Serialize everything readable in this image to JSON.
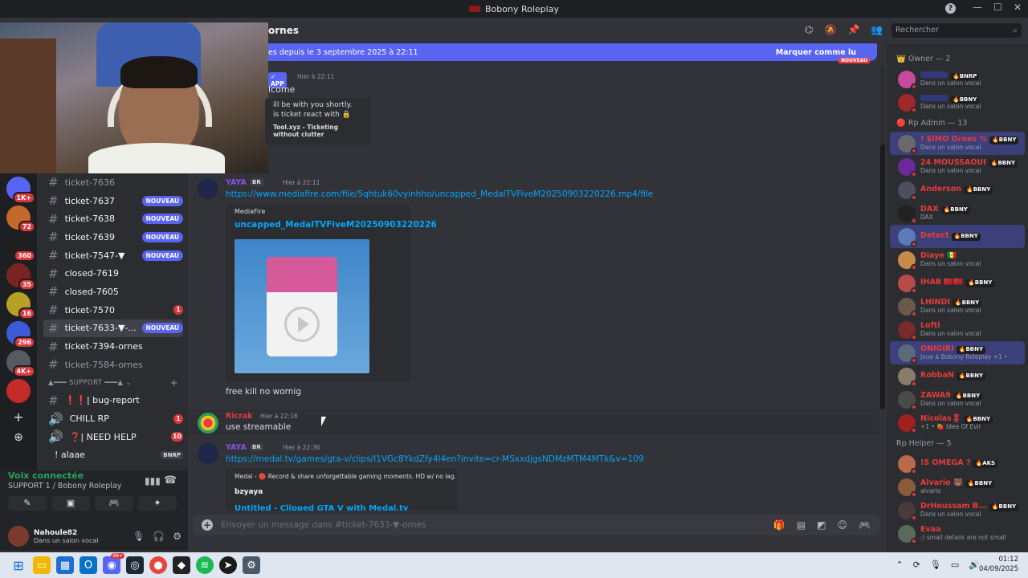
{
  "window": {
    "title": "Bobony Roleplay",
    "help": "?",
    "min": "—",
    "max": "☐",
    "close": "✕"
  },
  "servers": {
    "items": [
      {
        "name": "server-1",
        "badge": "1K+",
        "color": "#5865f2"
      },
      {
        "name": "server-2",
        "badge": "72",
        "color": "#c4692b"
      },
      {
        "name": "server-3",
        "badge": "360",
        "color": "#1f1f1f"
      },
      {
        "name": "server-4",
        "badge": "35",
        "color": "#7a2323"
      },
      {
        "name": "server-5",
        "badge": "16",
        "color": "#b8a024"
      },
      {
        "name": "server-6",
        "badge": "296",
        "color": "#3d5bd8"
      },
      {
        "name": "server-7",
        "badge": "4K+",
        "color": "#555a63"
      },
      {
        "name": "server-8",
        "badge": "",
        "color": "#c42a2a"
      }
    ],
    "add_icon": "+",
    "explore_icon": "⊕"
  },
  "channels": {
    "items": [
      {
        "label": "ticket-7636",
        "badge": "",
        "type": "none",
        "state": "read"
      },
      {
        "label": "ticket-7637",
        "badge": "NOUVEAU",
        "type": "new",
        "state": "unread"
      },
      {
        "label": "ticket-7638",
        "badge": "NOUVEAU",
        "type": "new",
        "state": "unread"
      },
      {
        "label": "ticket-7639",
        "badge": "NOUVEAU",
        "type": "new",
        "state": "unread"
      },
      {
        "label": "ticket-7547-▼",
        "badge": "NOUVEAU",
        "type": "new",
        "state": "unread"
      },
      {
        "label": "closed-7619",
        "badge": "",
        "type": "none",
        "state": "unread"
      },
      {
        "label": "closed-7605",
        "badge": "",
        "type": "none",
        "state": "unread"
      },
      {
        "label": "ticket-7570",
        "badge": "1",
        "type": "red",
        "state": "unread"
      },
      {
        "label": "ticket-7633-▼-...",
        "badge": "NOUVEAU",
        "type": "new",
        "state": "sel"
      },
      {
        "label": "ticket-7394-ornes",
        "badge": "",
        "type": "none",
        "state": "unread"
      },
      {
        "label": "ticket-7584-ornes",
        "badge": "",
        "type": "none",
        "state": "read"
      }
    ],
    "category": "▲━━━ SUPPORT ━━━▲ ⌄",
    "category_add": "+",
    "after": [
      {
        "label": "❗❗| bug-report",
        "badge": "",
        "type": "none",
        "icon": "#"
      },
      {
        "label": "CHILL RP",
        "badge": "1",
        "type": "red",
        "icon": "🔊"
      },
      {
        "label": "❓| NEED HELP",
        "badge": "10",
        "type": "red",
        "icon": "🔊"
      },
      {
        "label": "! alaae",
        "badge": "BNRP",
        "type": "voice",
        "icon": ""
      }
    ]
  },
  "voice": {
    "connected": "Voix connectée",
    "server": "SUPPORT 1 / Bobony Roleplay",
    "btn1": "✎",
    "btn2": "▣",
    "btn3": "🎮",
    "btn4": "✦"
  },
  "user": {
    "name": "Nahoule82",
    "status": "Dans un salon vocal"
  },
  "header": {
    "channel": "ornes",
    "search_placeholder": "Rechercher"
  },
  "newbar": {
    "text": "es depuis le 3 septembre 2025 à 22:11",
    "mark": "Marquer comme lu",
    "divider": "NOUVEAU"
  },
  "messages": {
    "bot": {
      "tag": "✓ APP",
      "time": "Hier à 22:11",
      "line1": "lcome",
      "e1": "ill be with you shortly.",
      "e2": "is ticket react with 🔒",
      "e3": "Tool.xyz - Ticketing without clutter"
    },
    "yaya1": {
      "author": "YAYA",
      "badge": "BR",
      "time": "Hier à 22:11",
      "link": "https://www.mediafire.com/file/5qhtuk60vyinhho/uncapped_MedalTVFiveM20250903220226.mp4/file",
      "provider": "MediaFire",
      "etitle": "uncapped_MedalTVFiveM20250903220226",
      "text": "free kill no wornig"
    },
    "ricrak": {
      "author": "Ricrak",
      "time": "Hier à 22:18",
      "text": "use streamable"
    },
    "yaya2": {
      "author": "YAYA",
      "badge": "BR",
      "time": "Hier à 22:36",
      "link": "https://medal.tv/games/gta-v/clips/I1VGc8YkdZfy4I4en?invite=cr-MSxxdjgsNDMzMTM4MTk&v=109",
      "provider": "Medal - 🔴 Record & share unforgettable gaming moments. HD w/ no lag.",
      "eauthor": "bzyaya",
      "etitle": "Untitled - Clipped GTA V with Medal.tv"
    }
  },
  "composer": {
    "placeholder": "Envoyer un message dans #ticket-7633-▼-ornes"
  },
  "members": {
    "owner_hdr": "👑 Owner — 2",
    "owners": [
      {
        "name": "",
        "badge": "BNRP",
        "status": "Dans un salon vocal",
        "color": "#3b44c4",
        "ava": "#c84a9a"
      },
      {
        "name": "",
        "badge": "BBNY",
        "status": "Dans un salon vocal",
        "color": "#3b44c4",
        "ava": "#a02828"
      }
    ],
    "admin_hdr": "🔴 Rp Admin — 13",
    "admins": [
      {
        "name": "! $IMO Ornes %",
        "badge": "BBNY",
        "status": "Dans un salon vocal",
        "color": "#e83b3b",
        "ava": "#6a6a6a",
        "hl": true
      },
      {
        "name": "24 MOUSSAOUI",
        "badge": "BBNY",
        "status": "Dans un salon vocal",
        "color": "#e83b3b",
        "ava": "#6a2a9a",
        "hl": false
      },
      {
        "name": "Anderson",
        "badge": "BBNY",
        "status": "",
        "color": "#e83b3b",
        "ava": "#4a5060",
        "hl": false
      },
      {
        "name": "DAX",
        "badge": "BBNY",
        "status": "DAX",
        "color": "#e83b3b",
        "ava": "#222",
        "hl": false
      },
      {
        "name": "Detect",
        "badge": "BBNY",
        "status": "",
        "color": "#e83b3b",
        "ava": "#5a7ab8",
        "hl": true
      },
      {
        "name": "Diaye 🇸🇳",
        "badge": "",
        "status": "Dans un salon vocal",
        "color": "#e83b3b",
        "ava": "#c88a4a",
        "hl": false
      },
      {
        "name": "IHAB 🇲🇦🇲🇦",
        "badge": "BBNY",
        "status": "",
        "color": "#e83b3b",
        "ava": "#b84a4a",
        "hl": false
      },
      {
        "name": "LHINDI",
        "badge": "BBNY",
        "status": "Dans un salon vocal",
        "color": "#e83b3b",
        "ava": "#6a5a4a",
        "hl": false
      },
      {
        "name": "Lofti",
        "badge": "",
        "status": "Dans un salon vocal",
        "color": "#e83b3b",
        "ava": "#7a2a2a",
        "hl": false
      },
      {
        "name": "ONIGIRI",
        "badge": "BBNY",
        "status": "Joue à Bobony Roleplay +1 •",
        "color": "#e83b3b",
        "ava": "#5a6a7a",
        "hl": true
      },
      {
        "name": "RobbaN",
        "badge": "BBNY",
        "status": "",
        "color": "#e83b3b",
        "ava": "#8a7a6a",
        "hl": false
      },
      {
        "name": "ZAWA9",
        "badge": "BBNY",
        "status": "Dans un salon vocal",
        "color": "#e83b3b",
        "ava": "#4a4a4a",
        "hl": false
      },
      {
        "name": "Nicolas🎖",
        "badge": "BBNY",
        "status": "+1 • 🍓 Idea Of Evil",
        "color": "#e83b3b",
        "ava": "#a02020",
        "hl": false
      }
    ],
    "helper_hdr": "Rp Helper — 5",
    "helpers": [
      {
        "name": "!S  OMEGA ?",
        "badge": "AKS",
        "status": "",
        "color": "#e83b3b",
        "ava": "#b86a4a"
      },
      {
        "name": "Alvario 🐻",
        "badge": "BBNY",
        "status": "alvario",
        "color": "#e83b3b",
        "ava": "#8a5a3a"
      },
      {
        "name": "DrHoussam B...",
        "badge": "BBNY",
        "status": "Dans un salon vocal",
        "color": "#e83b3b",
        "ava": "#4a3a3a"
      },
      {
        "name": "Evaa",
        "badge": "",
        "status": ":) small details are not small",
        "color": "#e83b3b",
        "ava": "#5a6a5a"
      }
    ]
  },
  "taskbar": {
    "time": "01:12",
    "date": "04/09/2025",
    "discord_badge": "99+"
  }
}
